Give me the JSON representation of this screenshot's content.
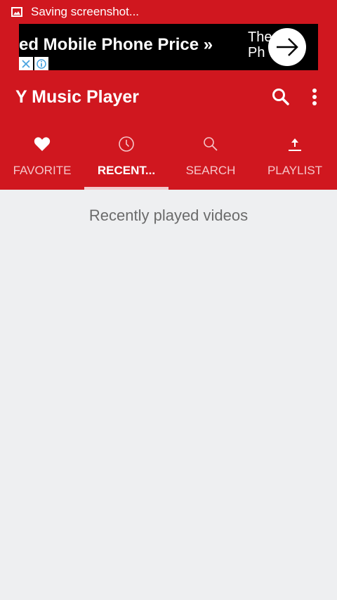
{
  "status_bar": {
    "notification_text": "Saving screenshot..."
  },
  "ad": {
    "headline": "ed Mobile Phone Price »",
    "side_line1": "The",
    "side_line2": "Ph"
  },
  "app_bar": {
    "title": "Y Music Player"
  },
  "tabs": [
    {
      "label": "FAVORITE",
      "icon": "heart-icon"
    },
    {
      "label": "RECENT...",
      "icon": "clock-icon"
    },
    {
      "label": "SEARCH",
      "icon": "search-icon"
    },
    {
      "label": "PLAYLIST",
      "icon": "upload-icon"
    }
  ],
  "content": {
    "empty_message": "Recently played videos"
  },
  "colors": {
    "primary": "#d0171f",
    "background": "#eeeff1",
    "ad_background": "#000000"
  }
}
